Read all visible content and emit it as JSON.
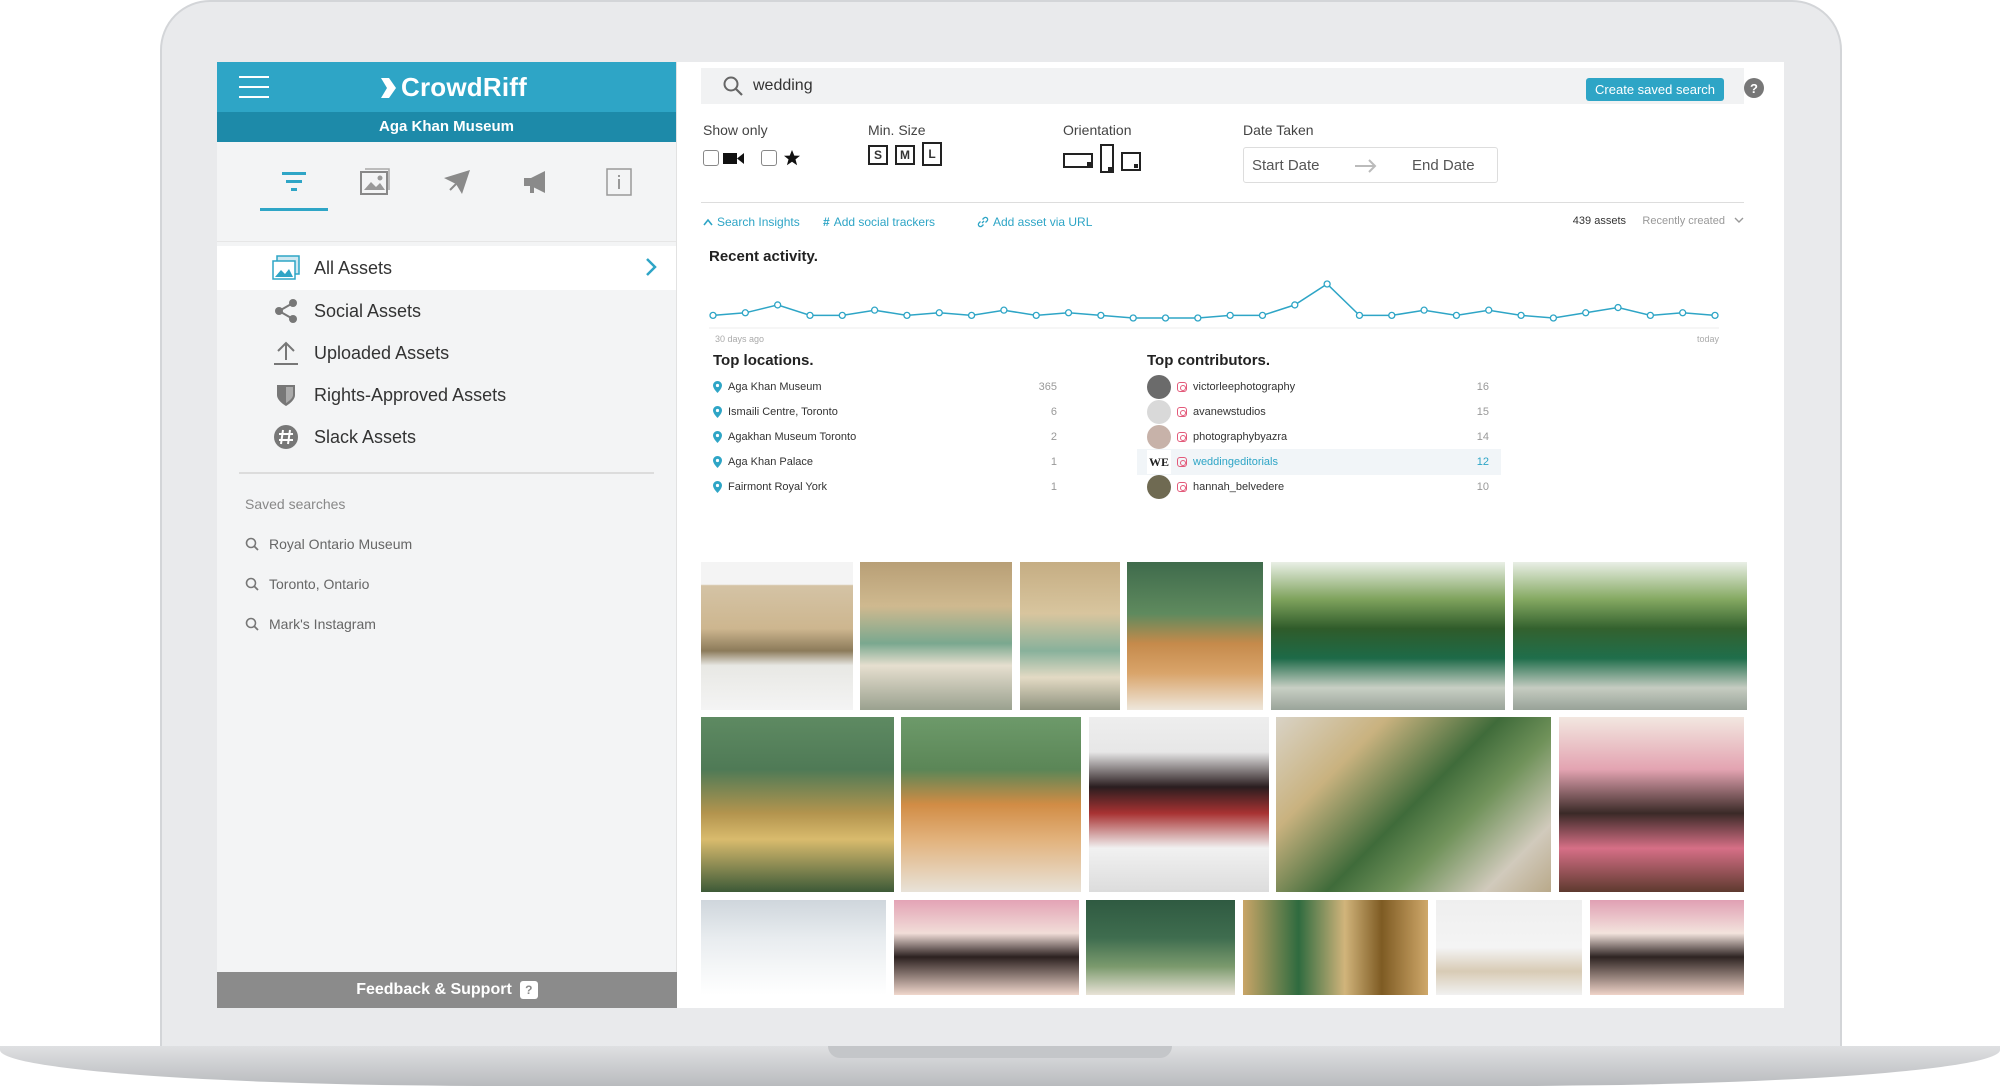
{
  "app": {
    "brand": "CrowdRiff",
    "org": "Aga Khan Museum"
  },
  "sidebar": {
    "tabs": [
      {
        "name": "tab-filters",
        "icon": "filter-icon"
      },
      {
        "name": "tab-galleries",
        "icon": "image-icon"
      },
      {
        "name": "tab-stories",
        "icon": "paper-plane-icon"
      },
      {
        "name": "tab-campaigns",
        "icon": "megaphone-icon"
      },
      {
        "name": "tab-info",
        "icon": "info-icon"
      }
    ],
    "items": [
      {
        "label": "All Assets",
        "icon": "images-icon",
        "active": true
      },
      {
        "label": "Social Assets",
        "icon": "share-icon"
      },
      {
        "label": "Uploaded Assets",
        "icon": "upload-icon"
      },
      {
        "label": "Rights-Approved Assets",
        "icon": "shield-icon"
      },
      {
        "label": "Slack Assets",
        "icon": "slack-icon"
      }
    ],
    "saved_title": "Saved searches",
    "saved": [
      "Royal Ontario Museum",
      "Toronto, Ontario",
      "Mark's Instagram"
    ],
    "feedback": "Feedback & Support",
    "feedback_icon": "?"
  },
  "search": {
    "value": "wedding",
    "create_label": "Create saved search",
    "help": "?"
  },
  "filters": {
    "show_only": "Show only",
    "min_size": "Min. Size",
    "sizes": [
      "S",
      "M",
      "L"
    ],
    "orientation": "Orientation",
    "date_taken": "Date Taken",
    "start_placeholder": "Start Date",
    "end_placeholder": "End Date"
  },
  "insights_bar": {
    "search_insights": "Search Insights",
    "add_trackers": "Add social trackers",
    "add_url": "Add asset via URL",
    "count": "439 assets",
    "sort": "Recently created"
  },
  "activity": {
    "title": "Recent activity.",
    "start_label": "30 days ago",
    "end_label": "today",
    "values": [
      0,
      1,
      4,
      0,
      0,
      2,
      0,
      1,
      0,
      2,
      0,
      1,
      0,
      -1,
      -1,
      -1,
      0,
      0,
      4,
      12,
      0,
      0,
      2,
      0,
      2,
      0,
      -1,
      1,
      3,
      0,
      1,
      0
    ]
  },
  "locations": {
    "title": "Top locations.",
    "rows": [
      {
        "name": "Aga Khan Museum",
        "count": "365"
      },
      {
        "name": "Ismaili Centre, Toronto",
        "count": "6"
      },
      {
        "name": "Agakhan Museum Toronto",
        "count": "2"
      },
      {
        "name": "Aga Khan Palace",
        "count": "1"
      },
      {
        "name": "Fairmont Royal York",
        "count": "1"
      }
    ]
  },
  "contributors": {
    "title": "Top contributors.",
    "rows": [
      {
        "name": "victorleephotography",
        "count": "16",
        "avatar": "#6b6b6b"
      },
      {
        "name": "avanewstudios",
        "count": "15",
        "avatar": "#d9d9d9"
      },
      {
        "name": "photographybyazra",
        "count": "14",
        "avatar": "#c7b2a9"
      },
      {
        "name": "weddingeditorials",
        "count": "12",
        "avatar": "WE",
        "highlight": true
      },
      {
        "name": "hannah_belvedere",
        "count": "10",
        "avatar": "#6f6a52"
      }
    ]
  },
  "colors": {
    "accent": "#2ea5c6",
    "accent_dark": "#1d8aa9",
    "sidebar_bg": "#f3f4f5"
  },
  "gallery": {
    "photos": [
      {
        "name": "photo-lanterns-table",
        "bg": "linear-gradient(180deg,#f4f4f4 0%,#f4f4f4 15%,#d4c3a5 16%,#cdb68f 45%,#8c7b5a 60%,#e8e8e4 70%,#f4f4f4 100%)"
      },
      {
        "name": "photo-couple-lanterns-1",
        "bg": "linear-gradient(180deg,#b89f76 0%,#cfb98f 30%,#7aa88f 55%,#e6dfcf 70%,#9aa18f 100%)"
      },
      {
        "name": "photo-couple-lanterns-2",
        "bg": "linear-gradient(180deg,#c5ad83 0%,#d8c59e 35%,#88b19b 60%,#e3dac4 78%,#8f937f 100%)"
      },
      {
        "name": "photo-dog-door-1",
        "bg": "linear-gradient(180deg,#3f6b4c 0%,#5f8a5e 35%,#c58a4b 55%,#d9a46a 75%,#eee7dc 100%)"
      },
      {
        "name": "photo-green-banquet-1",
        "bg": "linear-gradient(180deg,#e9efe6 0%,#7fa35d 25%,#2f5b2a 45%,#1d6a48 65%,#c8cfc4 85%,#9aa49a 100%)"
      },
      {
        "name": "photo-green-banquet-2",
        "bg": "linear-gradient(180deg,#e9efe6 0%,#85a962 25%,#33612e 45%,#1f6e4b 65%,#c5ccc1 85%,#98a298 100%)"
      },
      {
        "name": "photo-gold-door-display",
        "bg": "linear-gradient(180deg,#5e8a62 0%,#4f7a56 30%,#b3944e 55%,#d9bb6d 70%,#3d5a38 100%)"
      },
      {
        "name": "photo-dog-door-2",
        "bg": "linear-gradient(180deg,#6d9a6a 0%,#5b8657 30%,#d18c45 50%,#e2b27c 70%,#e8e2d8 100%)"
      },
      {
        "name": "photo-lion-dance-couple",
        "bg": "linear-gradient(180deg,#eeeeee 0%,#e7e7e7 20%,#2a1d1f 40%,#a83232 55%,#f1f1f1 75%,#dcdcdc 100%)"
      },
      {
        "name": "photo-banquet-overhead",
        "bg": "linear-gradient(135deg,#d9d3c6 0%,#c9b27f 25%,#3f6b3a 50%,#70925a 65%,#d1cabc 85%,#b9a98a 100%)"
      },
      {
        "name": "photo-couple-flowers",
        "bg": "linear-gradient(180deg,#f2e7e0 0%,#e3a3b1 30%,#3a2a27 55%,#d66f86 75%,#5e3a2f 100%)"
      },
      {
        "name": "photo-snow-walk",
        "bg": "linear-gradient(180deg,#cfd6dc 0%,#e8ecef 40%,#f4f6f7 70%,#ffffff 100%)"
      },
      {
        "name": "photo-couple-blossom",
        "bg": "linear-gradient(180deg,#e3a3b5 0%,#f1ddd8 35%,#2c2120 60%,#f0d7cc 100%)"
      },
      {
        "name": "photo-green-door",
        "bg": "linear-gradient(180deg,#2f5a41 0%,#3f6d4f 40%,#7b9a6d 70%,#e9e3d7 100%)"
      },
      {
        "name": "photo-shoes-lattice",
        "bg": "linear-gradient(90deg,#c9a567 0%,#2f6b3f 30%,#d1b47b 55%,#7e5b23 75%,#cfa86a 100%)"
      },
      {
        "name": "photo-groom-white",
        "bg": "linear-gradient(180deg,#efefef 0%,#f4f4f4 50%,#d8cbb5 75%,#f1f1f1 100%)"
      },
      {
        "name": "photo-couple-blossom-2",
        "bg": "linear-gradient(180deg,#e0a0b3 0%,#f3e3dd 35%,#2e2422 60%,#efd3c8 100%)"
      }
    ]
  }
}
